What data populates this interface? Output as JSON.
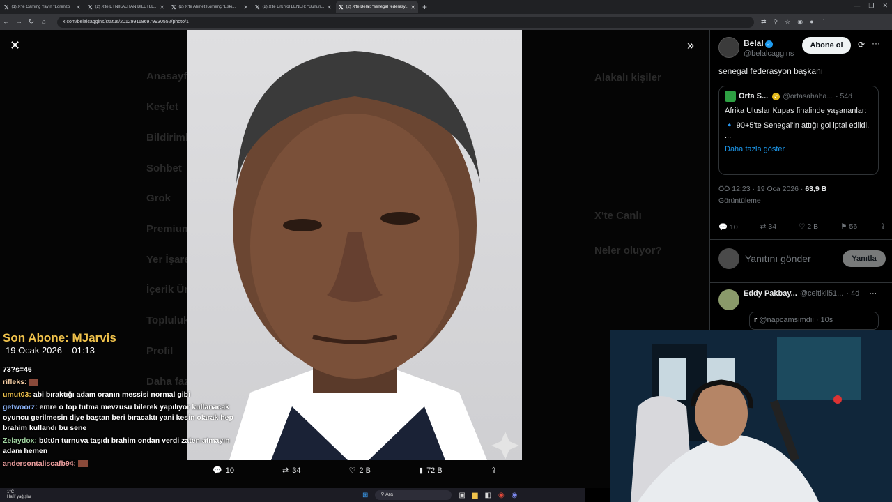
{
  "browser": {
    "tabs": [
      {
        "title": "(1) X'te Gaming Yayın \"Lorenzo"
      },
      {
        "title": "(2) X'te ETNİKALİTAN BİLETLE..."
      },
      {
        "title": "(2) X'te Ahmet Komenç \"Eski..."
      },
      {
        "title": "(2) X'te Erk Yol LENER: \"Bunun..."
      },
      {
        "title": "(2) X'te Belal: \"senegal federasy...",
        "active": true
      }
    ],
    "url": "x.com/belalcaggins/status/2012991186979930552/photo/1"
  },
  "background_nav": [
    "Anasayfa",
    "Keşfet",
    "Bildirimler",
    "Sohbet",
    "Grok",
    "Premium",
    "Yer İşaretleri",
    "İçerik Üreticiler",
    "Topluluklar",
    "Profil",
    "Daha fazla"
  ],
  "background_right": {
    "related": "Alakalı kişiler",
    "whats_happening": "Neler oluyor?",
    "live": "X'te Canlı"
  },
  "photo_actions": {
    "replies": "10",
    "reposts": "34",
    "likes": "2 B",
    "views": "72 B"
  },
  "overlay": {
    "title": "Son Abone: MJarvis",
    "date": "19 Ocak 2026",
    "time": "01:13",
    "chat": [
      {
        "user": "",
        "text": "73?s=46",
        "color": "#ffffff"
      },
      {
        "user": "rifleks:",
        "text": "",
        "color": "#f0c9a0"
      },
      {
        "user": "umut03:",
        "text": "abi bıraktığı adam oranın messisi normal gibi",
        "color": "#f0c24b"
      },
      {
        "user": "getwoorz:",
        "text": "emre o top tutma mevzusu bilerek yapılıyor kullanacak oyuncu gerilmesin diye baştan beri bıracaktı yani kesin olarak hep brahim kullandı bu sene",
        "color": "#8fb8ff"
      },
      {
        "user": "Zelaydox:",
        "text": "bütün turnuva taşıdı brahim ondan verdi zaten atmayın adam hemen",
        "color": "#9fd39f"
      },
      {
        "user": "andersontaliscafb94:",
        "text": "",
        "color": "#f0a0a0"
      }
    ]
  },
  "tweet": {
    "author": "Belal",
    "handle": "@belalcaggins",
    "follow_label": "Abone ol",
    "text": "senegal federasyon başkanı",
    "quote": {
      "author": "Orta S...",
      "handle": "@ortasahaha...",
      "age": "· 54d",
      "body1": "Afrika Uluslar Kupas finalinde yaşananlar:",
      "body2": "🔹 90+5'te Senegal'in attığı gol iptal edildi. ...",
      "more": "Daha fazla göster"
    },
    "time": "ÖÖ 12:23 · 19 Oca 2026 ·",
    "views": "63,9 B",
    "views_label": "Görüntüleme",
    "stats": {
      "replies": "10",
      "reposts": "34",
      "likes": "2 B",
      "bookmarks": "56"
    },
    "reply_placeholder": "Yanıtını gönder",
    "reply_button": "Yanıtla",
    "comment": {
      "author": "Eddy Pakbay...",
      "handle": "@celtikli51...",
      "age": "· 4d",
      "sub_author": "r",
      "sub_handle": "@napcamsimdii · 10s"
    }
  },
  "taskbar": {
    "weather_temp": "1°C",
    "weather_desc": "Hafif yağışlar",
    "search": "Ara"
  }
}
